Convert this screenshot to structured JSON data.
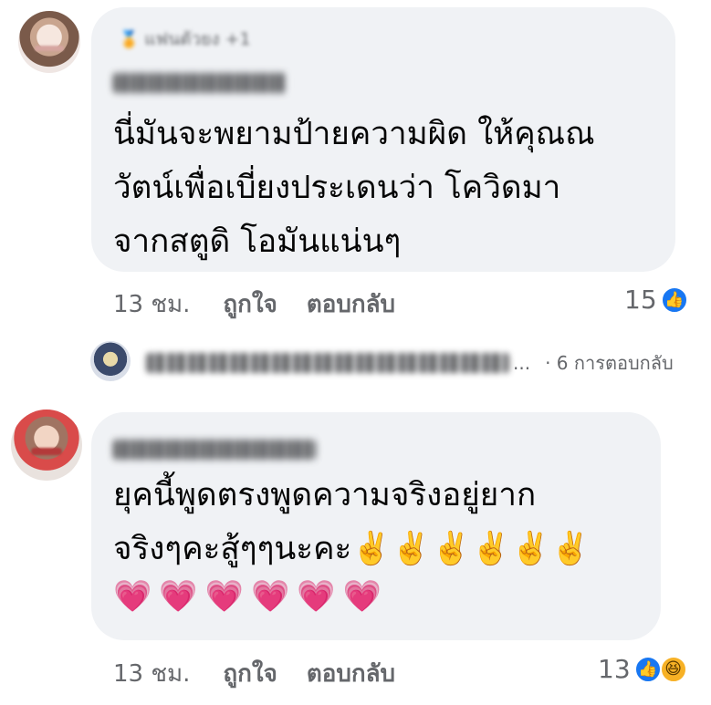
{
  "comment1": {
    "badge_text": "แฟนตัวยง +1",
    "text": "นี่มันจะพยามป้ายความผิด ให้คุณณ\nวัตน์เพื่อเบี่ยงประเดนว่า โควิดมา\nจากสตูดิ โอมันแน่นๆ",
    "time": "13 ชม.",
    "like_label": "ถูกใจ",
    "reply_label": "ตอบกลับ",
    "reaction_count": "15"
  },
  "replies_summary": {
    "ellipsis": "...",
    "count_text": "· 6 การตอบกลับ"
  },
  "comment2": {
    "text": "ยุคนี้พูดตรงพูดความจริงอยู่ยาก\nจริงๆคะสู้ๆๆนะคะ✌️✌️✌️✌️✌️✌️",
    "hearts": [
      "💗",
      "💗",
      "💗",
      "💗",
      "💗",
      "💗"
    ],
    "time": "13 ชม.",
    "like_label": "ถูกใจ",
    "reply_label": "ตอบกลับ",
    "reaction_count": "13"
  },
  "icons": {
    "like": "👍",
    "haha": "😆",
    "badge": "🏅"
  },
  "colors": {
    "bubble": "#f0f2f5",
    "meta_text": "#65676b",
    "like_blue": "#1877f2",
    "heart_pink": "#e8479b"
  }
}
